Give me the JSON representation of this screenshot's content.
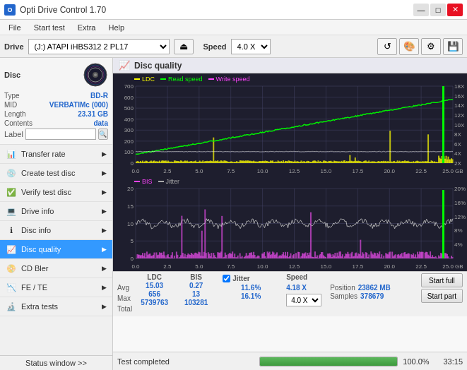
{
  "titlebar": {
    "title": "Opti Drive Control 1.70",
    "icon": "O",
    "controls": [
      "—",
      "□",
      "✕"
    ]
  },
  "menubar": {
    "items": [
      "File",
      "Start test",
      "Extra",
      "Help"
    ]
  },
  "drivebar": {
    "label": "Drive",
    "drive_value": "(J:)  ATAPI iHBS312  2 PL17",
    "speed_label": "Speed",
    "speed_value": "4.0 X"
  },
  "disc": {
    "title": "Disc",
    "type_label": "Type",
    "type_val": "BD-R",
    "mid_label": "MID",
    "mid_val": "VERBATIMc (000)",
    "length_label": "Length",
    "length_val": "23.31 GB",
    "contents_label": "Contents",
    "contents_val": "data",
    "label_label": "Label",
    "label_val": ""
  },
  "nav": {
    "items": [
      {
        "id": "transfer-rate",
        "label": "Transfer rate",
        "active": false
      },
      {
        "id": "create-test-disc",
        "label": "Create test disc",
        "active": false
      },
      {
        "id": "verify-test-disc",
        "label": "Verify test disc",
        "active": false
      },
      {
        "id": "drive-info",
        "label": "Drive info",
        "active": false
      },
      {
        "id": "disc-info",
        "label": "Disc info",
        "active": false
      },
      {
        "id": "disc-quality",
        "label": "Disc quality",
        "active": true
      },
      {
        "id": "cd-bler",
        "label": "CD Bler",
        "active": false
      },
      {
        "id": "fe-te",
        "label": "FE / TE",
        "active": false
      },
      {
        "id": "extra-tests",
        "label": "Extra tests",
        "active": false
      }
    ],
    "status_window": "Status window >>"
  },
  "content": {
    "title": "Disc quality",
    "chart1": {
      "legend": [
        {
          "label": "LDC",
          "color": "#ffff00"
        },
        {
          "label": "Read speed",
          "color": "#00ff00"
        },
        {
          "label": "Write speed",
          "color": "#ff44ff"
        }
      ],
      "y_max": 700,
      "y_labels": [
        "700",
        "600",
        "500",
        "400",
        "300",
        "200",
        "100"
      ],
      "y2_labels": [
        "18X",
        "16X",
        "14X",
        "12X",
        "10X",
        "8X",
        "6X",
        "4X",
        "2X"
      ],
      "x_labels": [
        "0.0",
        "2.5",
        "5.0",
        "7.5",
        "10.0",
        "12.5",
        "15.0",
        "17.5",
        "20.0",
        "22.5",
        "25.0 GB"
      ]
    },
    "chart2": {
      "legend": [
        {
          "label": "BIS",
          "color": "#ff44ff"
        },
        {
          "label": "Jitter",
          "color": "#ffffff"
        }
      ],
      "y_max": 20,
      "y_labels": [
        "20",
        "15",
        "10",
        "5"
      ],
      "y2_labels": [
        "20%",
        "16%",
        "12%",
        "8%",
        "4%"
      ],
      "x_labels": [
        "0.0",
        "2.5",
        "5.0",
        "7.5",
        "10.0",
        "12.5",
        "15.0",
        "17.5",
        "20.0",
        "22.5",
        "25.0 GB"
      ]
    }
  },
  "stats": {
    "ldc_label": "LDC",
    "bis_label": "BIS",
    "jitter_label": "Jitter",
    "speed_label": "Speed",
    "avg_label": "Avg",
    "max_label": "Max",
    "total_label": "Total",
    "ldc_avg": "15.03",
    "ldc_max": "656",
    "ldc_total": "5739763",
    "bis_avg": "0.27",
    "bis_max": "13",
    "bis_total": "103281",
    "jitter_avg": "11.6%",
    "jitter_max": "16.1%",
    "speed_val": "4.18 X",
    "speed_select": "4.0 X",
    "position_label": "Position",
    "samples_label": "Samples",
    "position_val": "23862 MB",
    "samples_val": "378679",
    "start_full": "Start full",
    "start_part": "Start part"
  },
  "bottom": {
    "status": "Test completed",
    "progress": 100,
    "progress_pct": "100.0%",
    "time": "33:15"
  },
  "colors": {
    "ldc": "#ffff00",
    "read_speed": "#00ee00",
    "write_speed": "#ff44ff",
    "bis": "#ff44ff",
    "jitter": "#ffffff",
    "blue_accent": "#2266cc",
    "chart_bg": "#1e1e2e"
  }
}
